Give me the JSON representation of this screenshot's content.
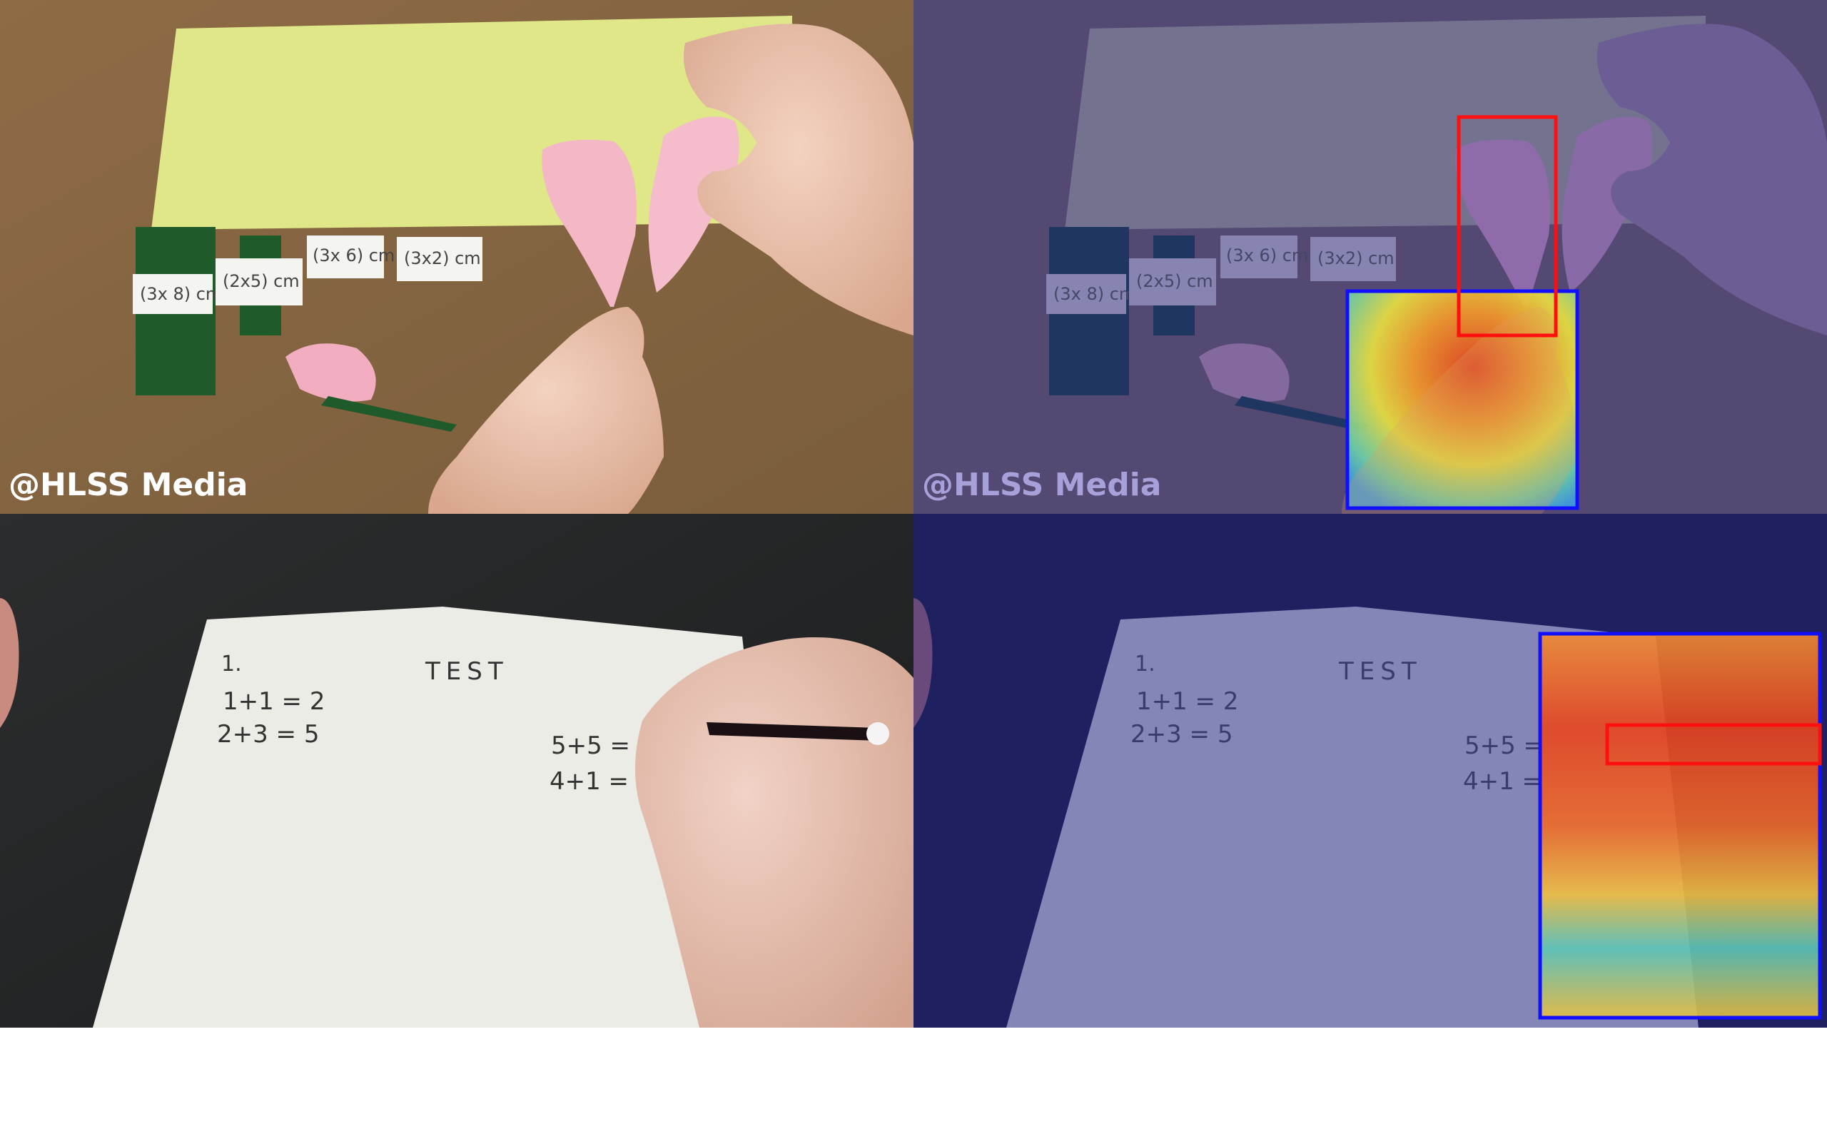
{
  "watermark": "@HLSS Media",
  "labels": [
    "(3x 8) cm",
    "(2x5) cm",
    "(3x 6) cm",
    "(3x2) cm"
  ],
  "test_title": "TEST",
  "equations": [
    "1.",
    "1+1 = 2",
    "2+3 = 5",
    "5+5 =",
    "4+1 ="
  ],
  "colors": {
    "table_brown": "#8a6a45",
    "yellow_paper": "#dfe789",
    "green_strip": "#1f5a2a",
    "pink_petal": "#f2aec0",
    "dark_table": "#2a2c2d",
    "paper_white": "#ecece6",
    "overlay_blue": "#2a2a8c",
    "box_blue": "#1010ff",
    "box_red": "#ff1010"
  }
}
